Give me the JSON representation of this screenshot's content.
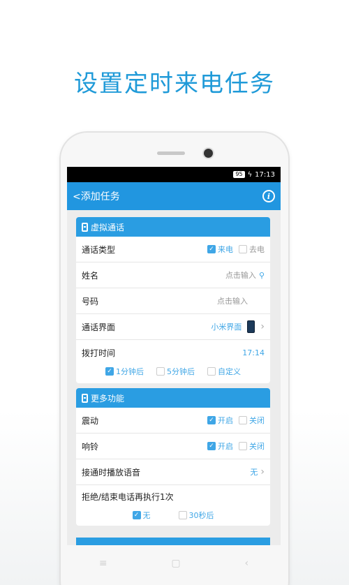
{
  "headline": "设置定时来电任务",
  "statusbar": {
    "battery": "95",
    "time": "17:13"
  },
  "appbar": {
    "back_label": "<添加任务",
    "info_icon": "i"
  },
  "virtual_call": {
    "header": "虚拟通话",
    "call_type": {
      "label": "通话类型",
      "options": [
        {
          "label": "来电",
          "checked": true
        },
        {
          "label": "去电",
          "checked": false
        }
      ]
    },
    "name": {
      "label": "姓名",
      "placeholder": "点击输入"
    },
    "number": {
      "label": "号码",
      "placeholder": "点击输入"
    },
    "ui": {
      "label": "通话界面",
      "value": "小米界面"
    },
    "dial_time": {
      "label": "拨打时间",
      "value": "17:14",
      "options": [
        {
          "label": "1分钟后",
          "checked": true
        },
        {
          "label": "5分钟后",
          "checked": false
        },
        {
          "label": "自定义",
          "checked": false
        }
      ]
    }
  },
  "more": {
    "header": "更多功能",
    "vibrate": {
      "label": "震动",
      "on": "开启",
      "off": "关闭",
      "checked_on": true
    },
    "ring": {
      "label": "响铃",
      "on": "开启",
      "off": "关闭",
      "checked_on": true
    },
    "voice": {
      "label": "接通时播放语音",
      "value": "无"
    },
    "repeat": {
      "label": "拒绝/结束电话再执行1次",
      "options": [
        {
          "label": "无",
          "checked": true
        },
        {
          "label": "30秒后",
          "checked": false
        }
      ]
    }
  },
  "navbar": {
    "menu": "≡",
    "home": "▢",
    "back": "‹"
  },
  "colors": {
    "accent": "#2196e0",
    "headline": "#1f9ad8"
  }
}
